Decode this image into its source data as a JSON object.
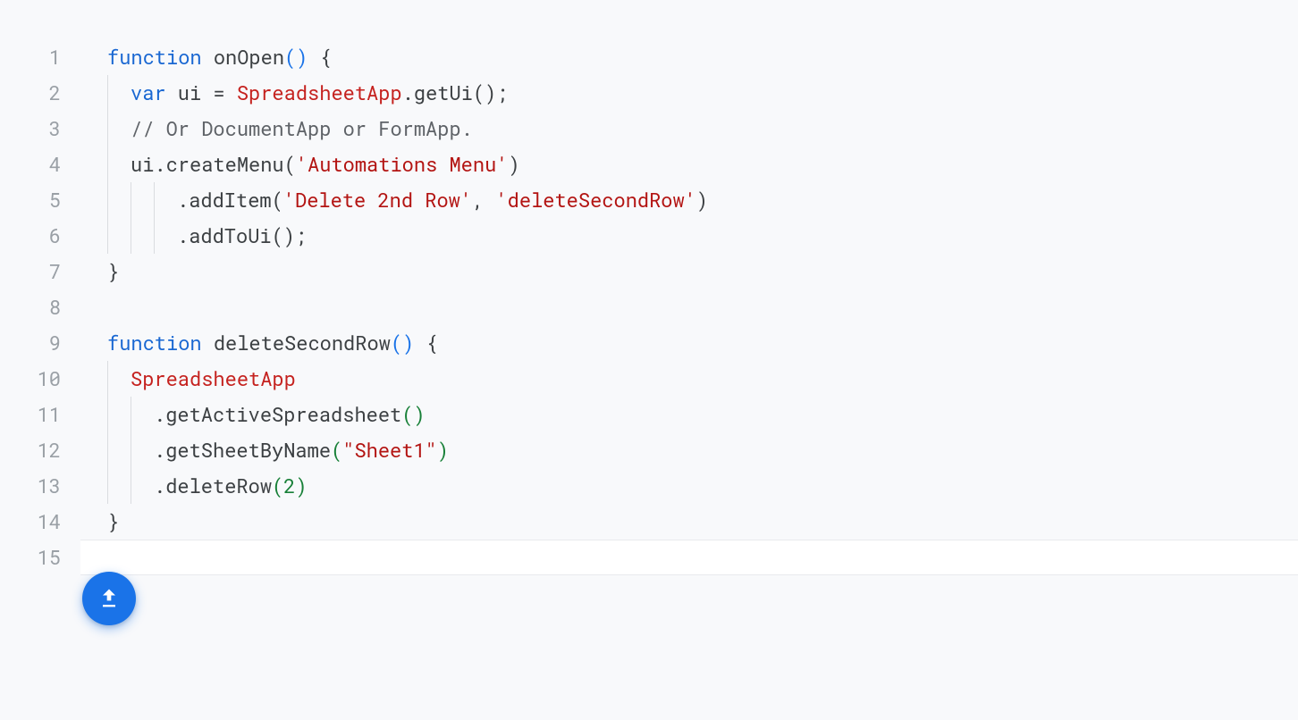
{
  "editor": {
    "line_count": 15,
    "current_line": 15,
    "colors": {
      "keyword": "#1967d2",
      "class": "#c5221f",
      "string": "#b31412",
      "comment": "#5f6368",
      "number": "#188038",
      "default": "#3c4043",
      "gutter": "#9aa0a6",
      "active_bg": "#ffffff",
      "page_bg": "#f8f9fb"
    },
    "lines": [
      {
        "n": 1,
        "indent": 0,
        "tokens": [
          {
            "t": "function",
            "c": "keyword"
          },
          {
            "t": " ",
            "c": "default"
          },
          {
            "t": "onOpen",
            "c": "default"
          },
          {
            "t": "()",
            "c": "paren-blue"
          },
          {
            "t": " ",
            "c": "default"
          },
          {
            "t": "{",
            "c": "punct"
          }
        ]
      },
      {
        "n": 2,
        "indent": 1,
        "tokens": [
          {
            "t": "var",
            "c": "keyword"
          },
          {
            "t": " ui ",
            "c": "default"
          },
          {
            "t": "=",
            "c": "punct"
          },
          {
            "t": " ",
            "c": "default"
          },
          {
            "t": "SpreadsheetApp",
            "c": "class"
          },
          {
            "t": ".",
            "c": "punct"
          },
          {
            "t": "getUi",
            "c": "default"
          },
          {
            "t": "();",
            "c": "punct"
          }
        ]
      },
      {
        "n": 3,
        "indent": 1,
        "tokens": [
          {
            "t": "// Or DocumentApp or FormApp.",
            "c": "comment"
          }
        ]
      },
      {
        "n": 4,
        "indent": 1,
        "tokens": [
          {
            "t": "ui",
            "c": "default"
          },
          {
            "t": ".",
            "c": "punct"
          },
          {
            "t": "createMenu",
            "c": "default"
          },
          {
            "t": "(",
            "c": "punct"
          },
          {
            "t": "'Automations Menu'",
            "c": "string"
          },
          {
            "t": ")",
            "c": "punct"
          }
        ]
      },
      {
        "n": 5,
        "indent": 3,
        "tokens": [
          {
            "t": ".",
            "c": "punct"
          },
          {
            "t": "addItem",
            "c": "default"
          },
          {
            "t": "(",
            "c": "punct"
          },
          {
            "t": "'Delete 2nd Row'",
            "c": "string"
          },
          {
            "t": ",",
            "c": "punct"
          },
          {
            "t": " ",
            "c": "default"
          },
          {
            "t": "'deleteSecondRow'",
            "c": "string"
          },
          {
            "t": ")",
            "c": "punct"
          }
        ]
      },
      {
        "n": 6,
        "indent": 3,
        "tokens": [
          {
            "t": ".",
            "c": "punct"
          },
          {
            "t": "addToUi",
            "c": "default"
          },
          {
            "t": "();",
            "c": "punct"
          }
        ]
      },
      {
        "n": 7,
        "indent": 0,
        "tokens": [
          {
            "t": "}",
            "c": "punct"
          }
        ]
      },
      {
        "n": 8,
        "indent": 0,
        "tokens": []
      },
      {
        "n": 9,
        "indent": 0,
        "tokens": [
          {
            "t": "function",
            "c": "keyword"
          },
          {
            "t": " ",
            "c": "default"
          },
          {
            "t": "deleteSecondRow",
            "c": "default"
          },
          {
            "t": "()",
            "c": "paren-blue"
          },
          {
            "t": " ",
            "c": "default"
          },
          {
            "t": "{",
            "c": "punct"
          }
        ]
      },
      {
        "n": 10,
        "indent": 1,
        "tokens": [
          {
            "t": "SpreadsheetApp",
            "c": "class"
          }
        ]
      },
      {
        "n": 11,
        "indent": 2,
        "tokens": [
          {
            "t": ".",
            "c": "punct"
          },
          {
            "t": "getActiveSpreadsheet",
            "c": "default"
          },
          {
            "t": "()",
            "c": "paren-green"
          }
        ]
      },
      {
        "n": 12,
        "indent": 2,
        "tokens": [
          {
            "t": ".",
            "c": "punct"
          },
          {
            "t": "getSheetByName",
            "c": "default"
          },
          {
            "t": "(",
            "c": "paren-green"
          },
          {
            "t": "\"Sheet1\"",
            "c": "string"
          },
          {
            "t": ")",
            "c": "paren-green"
          }
        ]
      },
      {
        "n": 13,
        "indent": 2,
        "tokens": [
          {
            "t": ".",
            "c": "punct"
          },
          {
            "t": "deleteRow",
            "c": "default"
          },
          {
            "t": "(",
            "c": "paren-green"
          },
          {
            "t": "2",
            "c": "number"
          },
          {
            "t": ")",
            "c": "paren-green"
          }
        ]
      },
      {
        "n": 14,
        "indent": 0,
        "tokens": [
          {
            "t": "}",
            "c": "punct"
          }
        ]
      },
      {
        "n": 15,
        "indent": 0,
        "tokens": [],
        "current": true
      }
    ]
  },
  "fab": {
    "icon": "upload-icon",
    "color": "#1a73e8"
  }
}
